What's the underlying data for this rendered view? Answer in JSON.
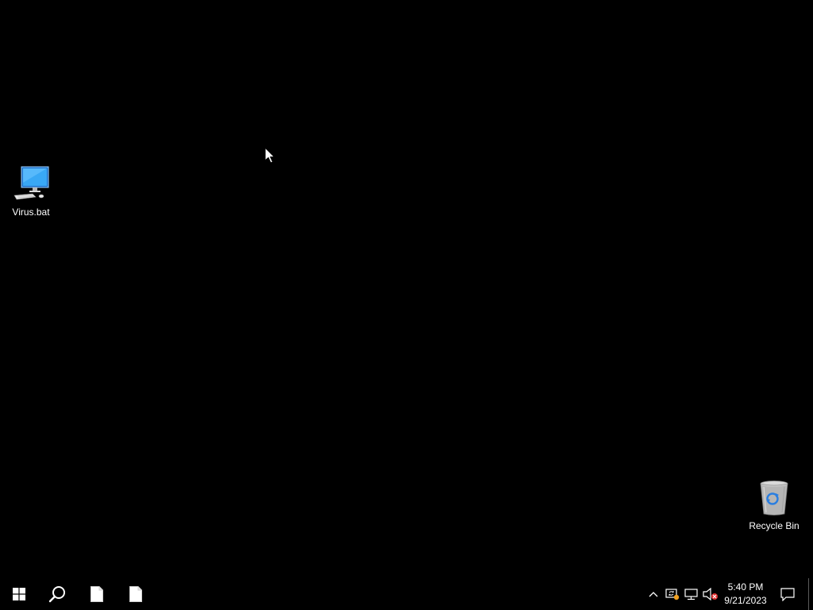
{
  "desktop": {
    "icons": [
      {
        "label": "Virus.bat",
        "icon": "computer-icon"
      },
      {
        "label": "Recycle Bin",
        "icon": "recycle-bin-icon"
      }
    ]
  },
  "taskbar": {
    "start_icon": "windows-logo-icon",
    "search_icon": "search-icon",
    "pinned": [
      {
        "icon": "file-icon"
      },
      {
        "icon": "file-icon"
      }
    ],
    "tray": {
      "icons": [
        "chevron-up-icon",
        "security-icon",
        "network-icon",
        "volume-muted-icon"
      ],
      "time": "5:40 PM",
      "date": "9/21/2023",
      "notification_icon": "notification-icon"
    }
  },
  "colors": {
    "desktop_background": "#000000",
    "taskbar_background": "#000000",
    "text": "#ffffff",
    "accent_blue": "#2aa0f0"
  }
}
